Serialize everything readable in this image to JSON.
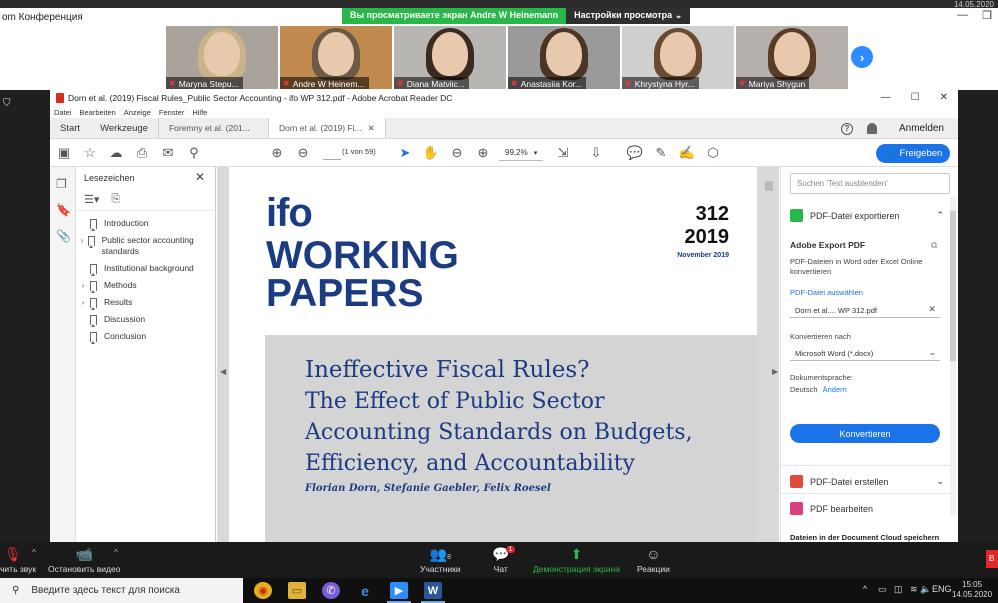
{
  "zoom": {
    "window_title": "om Конференция",
    "banner_viewing": "Вы просматриваете экран Andre W Heinemann",
    "banner_settings": "Настройки просмотра",
    "top_date": "14.05.2020",
    "participants": [
      {
        "name": "Maryna Stepu...",
        "hair": "#c9b48a",
        "bg": "#a9a39b"
      },
      {
        "name": "Andre W Heinem...",
        "hair": "#6b5a45",
        "bg": "#c18a4e"
      },
      {
        "name": "Diana Matviic...",
        "hair": "#3a2a20",
        "bg": "#b8b6b2"
      },
      {
        "name": "Anastasiia Kor...",
        "hair": "#4a3526",
        "bg": "#9a9a9a"
      },
      {
        "name": "Khrystyna Hyr...",
        "hair": "#6a4a30",
        "bg": "#cfcfcf"
      },
      {
        "name": "Mariya Shygun",
        "hair": "#5a3b26",
        "bg": "#b6b0ad"
      }
    ],
    "controls": {
      "mute_label": "чить звук",
      "video_label": "Остановить видео",
      "participants_label": "Участники",
      "participants_count": "8",
      "chat_label": "Чат",
      "chat_badge": "1",
      "share_label": "Демонстрация экрана",
      "reactions_label": "Реакции",
      "leave_label": "В"
    }
  },
  "acrobat": {
    "window_title": "Dorn et al. (2019) Fiscal Rules_Public Sector Accounting - ifo WP 312.pdf - Adobe Acrobat Reader DC",
    "menu": [
      "Datei",
      "Bearbeiten",
      "Anzeige",
      "Fenster",
      "Hilfe"
    ],
    "tabs": {
      "start": "Start",
      "tools": "Werkzeuge",
      "doc1": "Foremny et al. (201...",
      "doc2": "Dorn et al. (2019) Fi...",
      "login": "Anmelden"
    },
    "toolbar": {
      "page_of": "(1 von 59)",
      "zoom": "99,2%",
      "share_button": "Freigeben"
    },
    "bookmarks": {
      "title": "Lesezeichen",
      "items": [
        {
          "label": "Introduction",
          "expandable": false
        },
        {
          "label": "Public sector accounting standards",
          "expandable": true
        },
        {
          "label": "Institutional background",
          "expandable": false
        },
        {
          "label": "Methods",
          "expandable": true
        },
        {
          "label": "Results",
          "expandable": true
        },
        {
          "label": "Discussion",
          "expandable": false
        },
        {
          "label": "Conclusion",
          "expandable": false
        }
      ]
    },
    "document": {
      "brand_small": "ifo",
      "brand_line1": "WORKING",
      "brand_line2": "PAPERS",
      "number": "312",
      "year": "2019",
      "date": "November 2019",
      "title_line1": "Ineffective Fiscal Rules?",
      "title_line2": "The Effect of Public Sector",
      "title_line3": "Accounting Standards on Budgets,",
      "title_line4": "Efficiency, and Accountability",
      "authors": "Florian Dorn, Stefanie Gaebler, Felix Roesel"
    },
    "right_panel": {
      "search_placeholder": "Suchen 'Text ausblenden'",
      "export_title": "PDF-Datei exportieren",
      "export_sub_title": "Adobe Export PDF",
      "export_desc": "PDF-Dateien in Word oder Excel Online konvertieren",
      "choose_file": "PDF-Datei auswählen",
      "file_name": "Dorn et al.... WP 312.pdf",
      "convert_to_label": "Konvertieren nach",
      "convert_to_value": "Microsoft Word (*.docx)",
      "doc_lang_label": "Dokumentsprache:",
      "doc_lang_value": "Deutsch",
      "change_link": "Ändern",
      "convert_button": "Konvertieren",
      "create_pdf": "PDF-Datei erstellen",
      "edit_pdf": "PDF bearbeiten",
      "cloud_save": "Dateien in der Document Cloud speichern"
    }
  },
  "taskbar": {
    "search_placeholder": "Введите здесь текст для поиска",
    "lang": "ENG",
    "time": "15:05",
    "date": "14.05.2020"
  },
  "colors": {
    "zoom_green": "#2ab74a",
    "acrobat_blue": "#1a73e8",
    "ifo_blue": "#1b3c83"
  }
}
